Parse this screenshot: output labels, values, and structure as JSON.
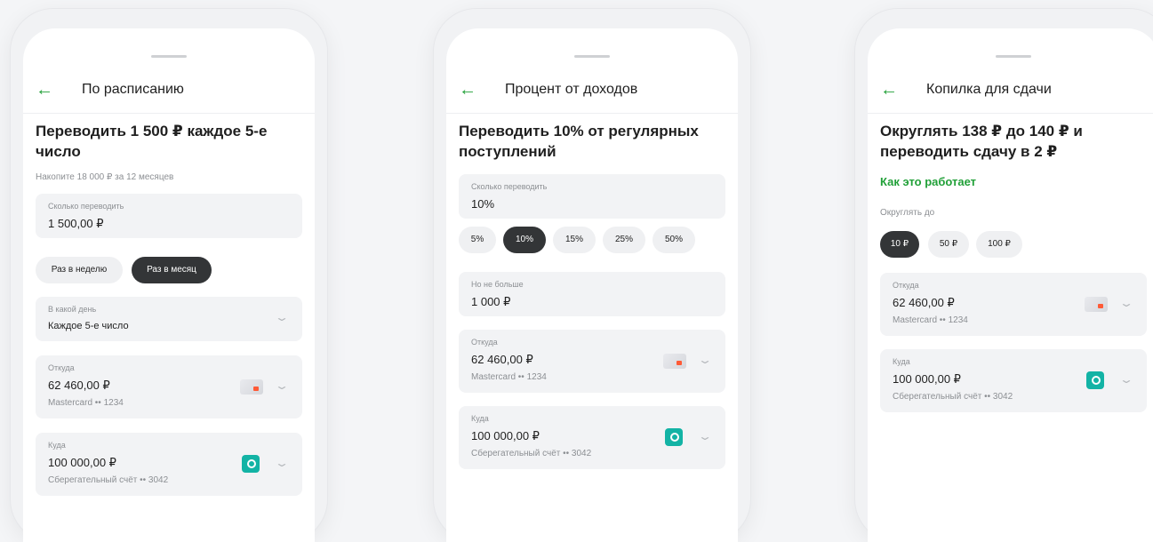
{
  "phones": [
    {
      "title": "По расписанию",
      "headline": "Переводить 1 500 ₽ каждое 5-е число",
      "hint": "Накопите 18 000 ₽ за 12 месяцев",
      "amount": {
        "label": "Сколько переводить",
        "value": "1 500,00 ₽"
      },
      "frequency": {
        "options": [
          "Раз в неделю",
          "Раз в месяц"
        ],
        "selected": "Раз в месяц"
      },
      "day": {
        "label": "В какой день",
        "value": "Каждое 5-е число"
      },
      "from": {
        "label": "Откуда",
        "value": "62 460,00 ₽",
        "sub": "Mastercard •• 1234"
      },
      "to": {
        "label": "Куда",
        "value": "100 000,00 ₽",
        "sub": "Сберегательный счёт •• 3042"
      }
    },
    {
      "title": "Процент от доходов",
      "headline": "Переводить 10% от регулярных поступлений",
      "amount": {
        "label": "Сколько переводить",
        "value": "10%"
      },
      "percents": {
        "options": [
          "5%",
          "10%",
          "15%",
          "25%",
          "50%"
        ],
        "selected": "10%"
      },
      "limit": {
        "label": "Но не больше",
        "value": "1 000 ₽"
      },
      "from": {
        "label": "Откуда",
        "value": "62 460,00 ₽",
        "sub": "Mastercard •• 1234"
      },
      "to": {
        "label": "Куда",
        "value": "100 000,00 ₽",
        "sub": "Сберегательный счёт •• 3042"
      }
    },
    {
      "title": "Копилка для сдачи",
      "headline": "Округлять 138 ₽ до 140 ₽ и переводить сдачу в 2 ₽",
      "how_link": "Как это работает",
      "round_label": "Округлять до",
      "rounds": {
        "options": [
          "10 ₽",
          "50 ₽",
          "100 ₽"
        ],
        "selected": "10 ₽"
      },
      "from": {
        "label": "Откуда",
        "value": "62 460,00 ₽",
        "sub": "Mastercard •• 1234"
      },
      "to": {
        "label": "Куда",
        "value": "100 000,00 ₽",
        "sub": "Сберегательный счёт •• 3042"
      }
    }
  ],
  "icons": {
    "back": "arrow-left-icon",
    "chevron": "chevron-down-icon",
    "source_card": "mastercard-icon",
    "target_account": "savings-account-icon"
  },
  "colors": {
    "accent": "#21a038",
    "chip_active": "#333537",
    "savings_icon": "#13b3a5",
    "card_bg": "#f2f3f5"
  }
}
